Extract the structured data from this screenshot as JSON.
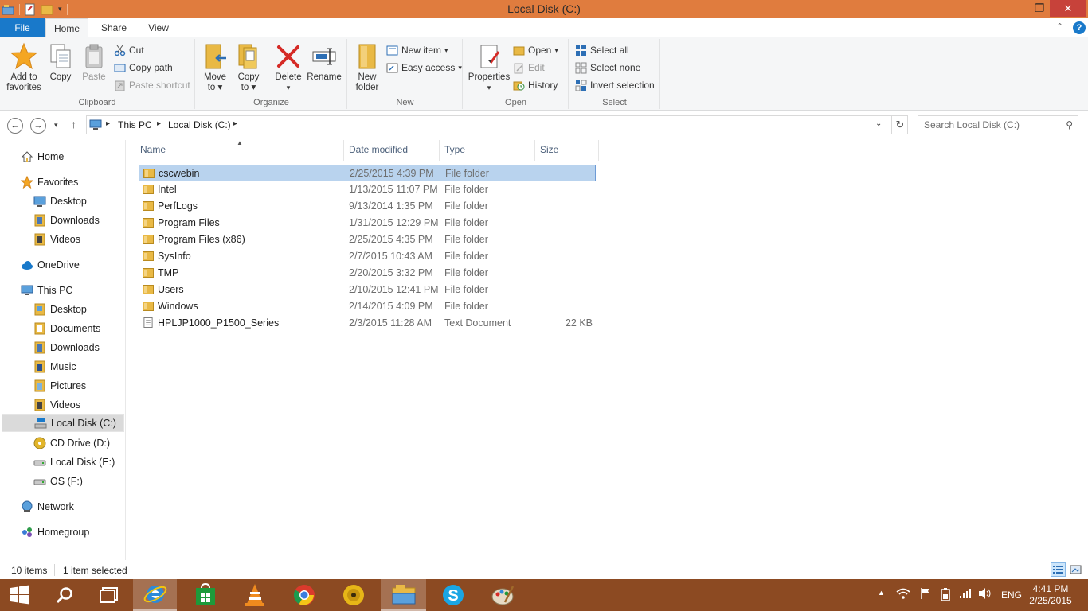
{
  "window": {
    "title": "Local Disk (C:)"
  },
  "ribbon_tabs": [
    "File",
    "Home",
    "Share",
    "View"
  ],
  "ribbon": {
    "clipboard": {
      "label": "Clipboard",
      "add_to_favorites": "Add to\nfavorites",
      "add_to_favorites_l1": "Add to",
      "add_to_favorites_l2": "favorites",
      "copy": "Copy",
      "paste": "Paste",
      "cut": "Cut",
      "copy_path": "Copy path",
      "paste_shortcut": "Paste shortcut"
    },
    "organize": {
      "label": "Organize",
      "move_to_l1": "Move",
      "move_to_l2": "to",
      "copy_to_l1": "Copy",
      "copy_to_l2": "to",
      "delete": "Delete",
      "rename": "Rename"
    },
    "new": {
      "label": "New",
      "new_folder_l1": "New",
      "new_folder_l2": "folder",
      "new_item": "New item",
      "easy_access": "Easy access"
    },
    "open": {
      "label": "Open",
      "properties": "Properties",
      "open": "Open",
      "edit": "Edit",
      "history": "History"
    },
    "select": {
      "label": "Select",
      "select_all": "Select all",
      "select_none": "Select none",
      "invert_selection": "Invert selection"
    }
  },
  "address": {
    "crumbs": [
      "This PC",
      "Local Disk (C:)"
    ],
    "search_placeholder": "Search Local Disk (C:)"
  },
  "nav": {
    "home": "Home",
    "favorites": "Favorites",
    "fav_desktop": "Desktop",
    "fav_downloads": "Downloads",
    "fav_videos": "Videos",
    "onedrive": "OneDrive",
    "this_pc": "This PC",
    "pc_desktop": "Desktop",
    "pc_documents": "Documents",
    "pc_downloads": "Downloads",
    "pc_music": "Music",
    "pc_pictures": "Pictures",
    "pc_videos": "Videos",
    "local_c": "Local Disk (C:)",
    "cd_d": "CD Drive (D:)",
    "local_e": "Local Disk (E:)",
    "os_f": "OS (F:)",
    "network": "Network",
    "homegroup": "Homegroup"
  },
  "columns": {
    "name": "Name",
    "date": "Date modified",
    "type": "Type",
    "size": "Size"
  },
  "files": [
    {
      "name": "cscwebin",
      "date": "2/25/2015 4:39 PM",
      "type": "File folder",
      "size": "",
      "kind": "folder"
    },
    {
      "name": "Intel",
      "date": "1/13/2015 11:07 PM",
      "type": "File folder",
      "size": "",
      "kind": "folder"
    },
    {
      "name": "PerfLogs",
      "date": "9/13/2014 1:35 PM",
      "type": "File folder",
      "size": "",
      "kind": "folder"
    },
    {
      "name": "Program Files",
      "date": "1/31/2015 12:29 PM",
      "type": "File folder",
      "size": "",
      "kind": "folder"
    },
    {
      "name": "Program Files (x86)",
      "date": "2/25/2015 4:35 PM",
      "type": "File folder",
      "size": "",
      "kind": "folder"
    },
    {
      "name": "SysInfo",
      "date": "2/7/2015 10:43 AM",
      "type": "File folder",
      "size": "",
      "kind": "folder"
    },
    {
      "name": "TMP",
      "date": "2/20/2015 3:32 PM",
      "type": "File folder",
      "size": "",
      "kind": "folder"
    },
    {
      "name": "Users",
      "date": "2/10/2015 12:41 PM",
      "type": "File folder",
      "size": "",
      "kind": "folder"
    },
    {
      "name": "Windows",
      "date": "2/14/2015 4:09 PM",
      "type": "File folder",
      "size": "",
      "kind": "folder"
    },
    {
      "name": "HPLJP1000_P1500_Series",
      "date": "2/3/2015 11:28 AM",
      "type": "Text Document",
      "size": "22 KB",
      "kind": "text"
    }
  ],
  "status": {
    "item_count": "10 items",
    "selection": "1 item selected"
  },
  "taskbar": {
    "tray_lang": "ENG",
    "time": "4:41 PM",
    "date": "2/25/2015"
  },
  "colors": {
    "titlebar": "#e07c3e",
    "taskbar": "#8c4a22",
    "accent": "#1979ca",
    "selection": "#b9d3ee"
  }
}
